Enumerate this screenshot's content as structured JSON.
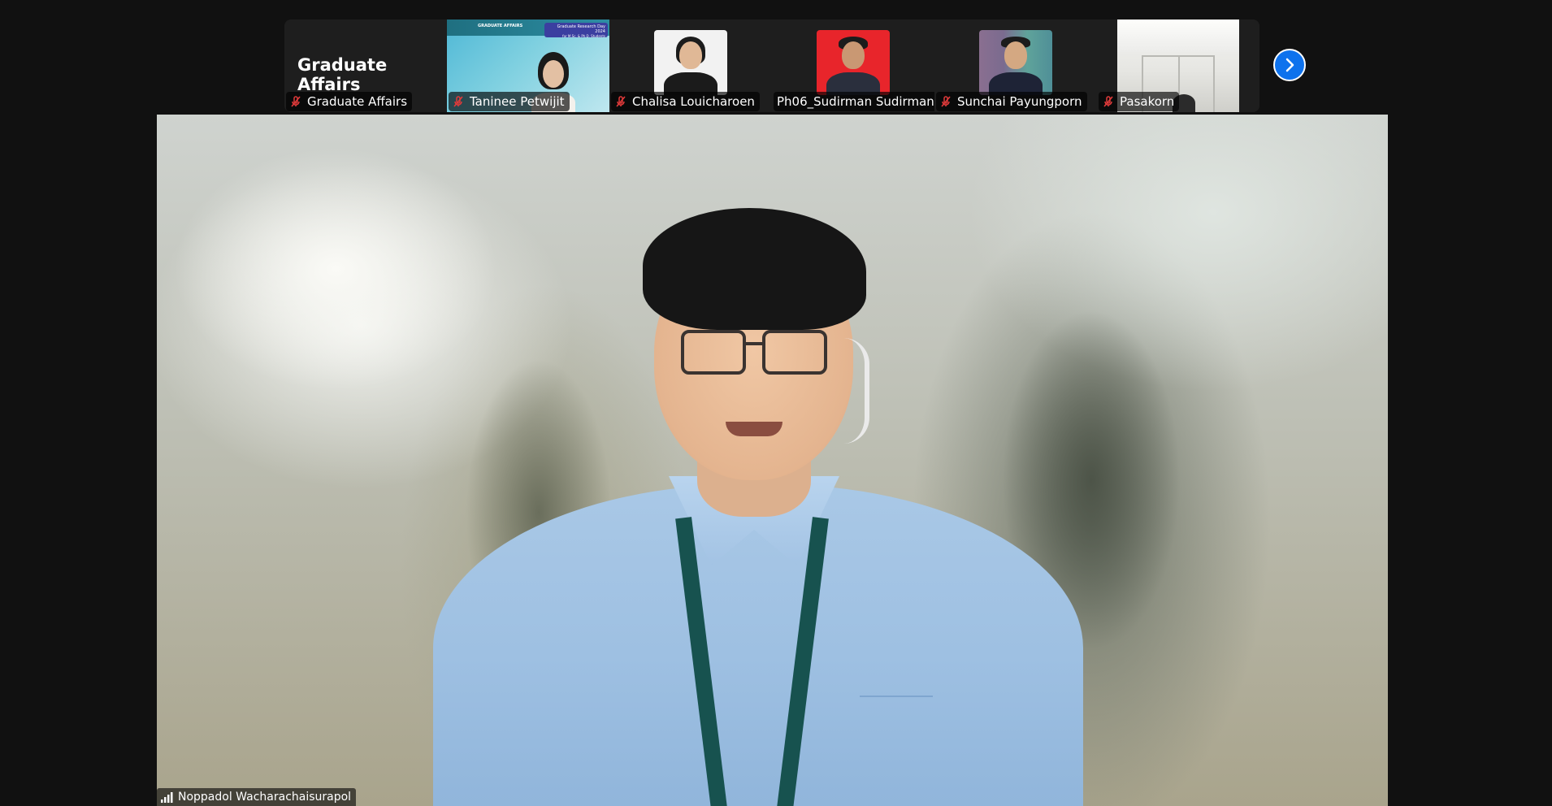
{
  "filmstrip": {
    "tiles": [
      {
        "display_text": "Graduate Affairs",
        "name": "Graduate Affairs",
        "muted": true
      },
      {
        "name": "Taninee Petwijit",
        "muted": true,
        "slide_title": "Graduate Research Day 2024",
        "slide_subtitle": "for M.Sc. & Ph.D. Students",
        "slide_badge": "GRADUATE AFFAIRS"
      },
      {
        "name": "Chalisa Louicharoen",
        "muted": true
      },
      {
        "name": "Ph06_Sudirman Sudirman",
        "muted": false
      },
      {
        "name": "Sunchai Payungporn",
        "muted": true
      },
      {
        "name": "Pasakorn",
        "muted": true
      }
    ]
  },
  "speaker": {
    "name": "Noppadol Wacharachaisurapol"
  },
  "colors": {
    "mute_icon": "#e03a3a",
    "accent": "#0e72ed",
    "background": "#111111",
    "tile_bg": "#1e1e1e"
  },
  "icons": [
    "muted-mic-icon",
    "chevron-right-icon",
    "signal-strength-icon"
  ]
}
